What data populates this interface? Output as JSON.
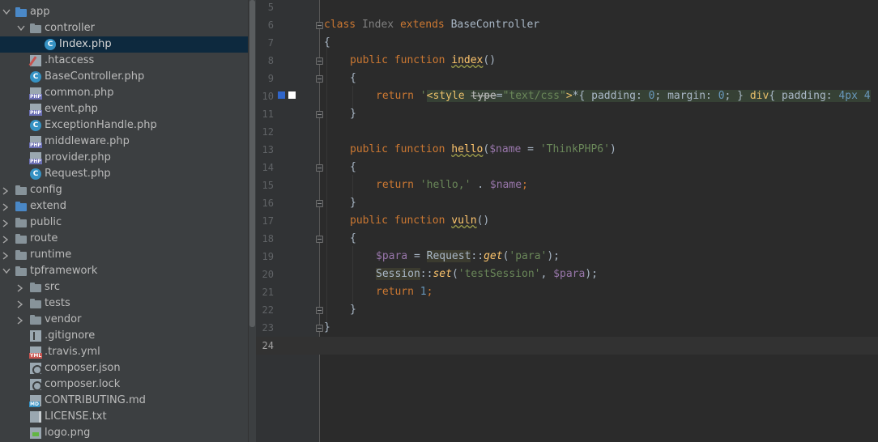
{
  "project_tree": {
    "items": [
      {
        "label": "app",
        "icon": "folder-icon",
        "expanded": true
      },
      {
        "label": "controller",
        "icon": "folder-icon",
        "expanded": true
      },
      {
        "label": "Index.php",
        "icon": "php-class-icon",
        "selected": true
      },
      {
        "label": ".htaccess",
        "icon": "htaccess-file-icon"
      },
      {
        "label": "BaseController.php",
        "icon": "php-class-icon"
      },
      {
        "label": "common.php",
        "icon": "php-file-icon"
      },
      {
        "label": "event.php",
        "icon": "php-file-icon"
      },
      {
        "label": "ExceptionHandle.php",
        "icon": "php-class-icon"
      },
      {
        "label": "middleware.php",
        "icon": "php-file-icon"
      },
      {
        "label": "provider.php",
        "icon": "php-file-icon"
      },
      {
        "label": "Request.php",
        "icon": "php-class-icon"
      },
      {
        "label": "config",
        "icon": "folder-icon",
        "expanded": false
      },
      {
        "label": "extend",
        "icon": "folder-icon",
        "expanded": false
      },
      {
        "label": "public",
        "icon": "folder-icon",
        "expanded": false
      },
      {
        "label": "route",
        "icon": "folder-icon",
        "expanded": false
      },
      {
        "label": "runtime",
        "icon": "folder-icon",
        "expanded": false
      },
      {
        "label": "tpframework",
        "icon": "folder-icon",
        "expanded": true
      },
      {
        "label": "src",
        "icon": "folder-icon",
        "expanded": false
      },
      {
        "label": "tests",
        "icon": "folder-icon",
        "expanded": false
      },
      {
        "label": "vendor",
        "icon": "folder-icon",
        "expanded": false
      },
      {
        "label": ".gitignore",
        "icon": "gitignore-file-icon"
      },
      {
        "label": ".travis.yml",
        "icon": "yml-file-icon"
      },
      {
        "label": "composer.json",
        "icon": "json-file-icon"
      },
      {
        "label": "composer.lock",
        "icon": "json-file-icon"
      },
      {
        "label": "CONTRIBUTING.md",
        "icon": "markdown-file-icon"
      },
      {
        "label": "LICENSE.txt",
        "icon": "text-file-icon"
      },
      {
        "label": "logo.png",
        "icon": "image-file-icon"
      }
    ]
  },
  "editor": {
    "line_numbers": [
      "5",
      "6",
      "7",
      "8",
      "9",
      "10",
      "11",
      "12",
      "13",
      "14",
      "15",
      "16",
      "17",
      "18",
      "19",
      "20",
      "21",
      "22",
      "23",
      "24"
    ],
    "current_line": "24",
    "color_swatches": [
      "#2f65ca",
      "#ffffff"
    ],
    "code": {
      "l6": {
        "class_kw": "class",
        "class_name": "Index",
        "extends_kw": "extends",
        "parent": "BaseController"
      },
      "l7": {
        "brace": "{"
      },
      "l8": {
        "public": "public",
        "function": "function",
        "name": "index",
        "parens": "()"
      },
      "l9": {
        "brace": "{"
      },
      "l10": {
        "return": "return",
        "quote": "'",
        "tag": "<style",
        "attr": "type",
        "eq": "=",
        "attrval": "\"text/css\"",
        "gt": ">",
        "css1": "*{ padding: ",
        "n1": "0",
        "css2": "; margin: ",
        "n2": "0",
        "css3": "; } ",
        "sel": "div",
        "css4": "{ padding: ",
        "n3": "4px 4"
      },
      "l11": {
        "brace": "}"
      },
      "l13": {
        "public": "public",
        "function": "function",
        "name": "hello",
        "open": "(",
        "var": "$name",
        "eq": " = ",
        "default": "'ThinkPHP6'",
        "close": ")"
      },
      "l14": {
        "brace": "{"
      },
      "l15": {
        "return": "return",
        "str": "'hello,'",
        "dot": " . ",
        "var": "$name",
        "semi": ";"
      },
      "l16": {
        "brace": "}"
      },
      "l17": {
        "public": "public",
        "function": "function",
        "name": "vuln",
        "parens": "()"
      },
      "l18": {
        "brace": "{"
      },
      "l19": {
        "var": "$para",
        "eq": " = ",
        "cls": "Request",
        "sep": "::",
        "method": "get",
        "open": "(",
        "arg": "'para'",
        "close": ");"
      },
      "l20": {
        "cls": "Session",
        "sep": "::",
        "method": "set",
        "open": "(",
        "arg1": "'testSession'",
        "comma": ", ",
        "var": "$para",
        "close": ");"
      },
      "l21": {
        "return": "return",
        "num": "1",
        "semi": ";"
      },
      "l22": {
        "brace": "}"
      },
      "l23": {
        "brace": "}"
      }
    }
  }
}
